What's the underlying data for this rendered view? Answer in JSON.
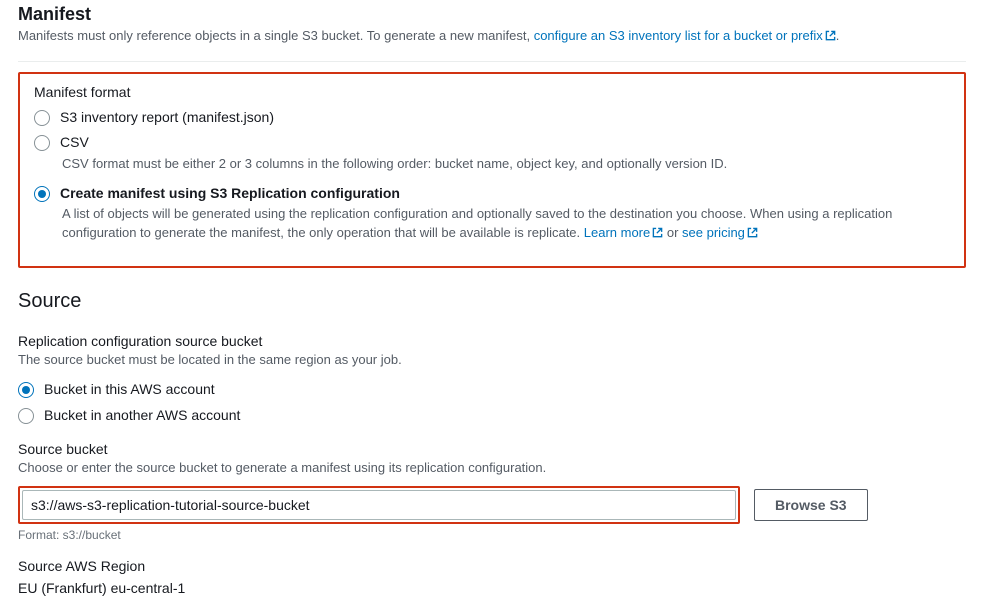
{
  "manifest": {
    "title": "Manifest",
    "desc_prefix": "Manifests must only reference objects in a single S3 bucket. To generate a new manifest, ",
    "desc_link": "configure an S3 inventory list for a bucket or prefix",
    "desc_suffix": "."
  },
  "manifest_format": {
    "label": "Manifest format",
    "options": {
      "inventory": {
        "label": "S3 inventory report (manifest.json)"
      },
      "csv": {
        "label": "CSV",
        "hint": "CSV format must be either 2 or 3 columns in the following order: bucket name, object key, and optionally version ID."
      },
      "replication": {
        "label": "Create manifest using S3 Replication configuration",
        "hint_prefix": "A list of objects will be generated using the replication configuration and optionally saved to the destination you choose. When using a replication configuration to generate the manifest, the only operation that will be available is replicate. ",
        "learn_more": "Learn more",
        "or": " or ",
        "see_pricing": "see pricing"
      }
    }
  },
  "source": {
    "title": "Source",
    "rep_bucket": {
      "label": "Replication configuration source bucket",
      "hint": "The source bucket must be located in the same region as your job.",
      "options": {
        "this": {
          "label": "Bucket in this AWS account"
        },
        "other": {
          "label": "Bucket in another AWS account"
        }
      }
    },
    "bucket": {
      "label": "Source bucket",
      "hint": "Choose or enter the source bucket to generate a manifest using its replication configuration.",
      "value": "s3://aws-s3-replication-tutorial-source-bucket",
      "browse": "Browse S3",
      "format": "Format: s3://bucket"
    },
    "region": {
      "label": "Source AWS Region",
      "value": "EU (Frankfurt) eu-central-1"
    }
  }
}
